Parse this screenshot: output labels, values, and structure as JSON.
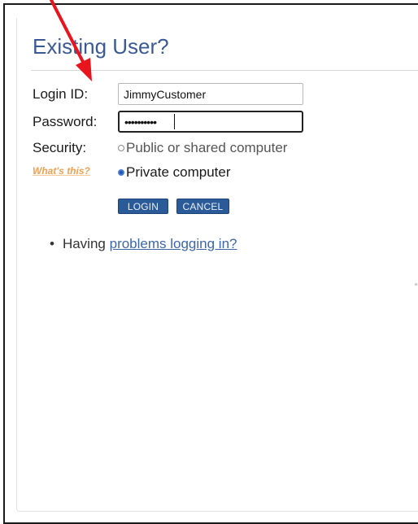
{
  "heading": "Existing User?",
  "form": {
    "login_label": "Login ID:",
    "login_value": "JimmyCustomer",
    "password_label": "Password:",
    "password_value": "••••••••••",
    "security_label": "Security:",
    "whats_this": "What's this?",
    "options": [
      {
        "label": "Public or shared computer",
        "selected": false
      },
      {
        "label": "Private computer",
        "selected": true
      }
    ],
    "login_button": "LOGIN",
    "cancel_button": "CANCEL"
  },
  "help": {
    "prefix": "Having",
    "link": "problems logging in?"
  },
  "colors": {
    "heading": "#3b5a94",
    "button": "#2a5a97",
    "whats_this": "#f0a050",
    "link": "#3e67a8",
    "annotation_arrow": "#e8141e"
  }
}
